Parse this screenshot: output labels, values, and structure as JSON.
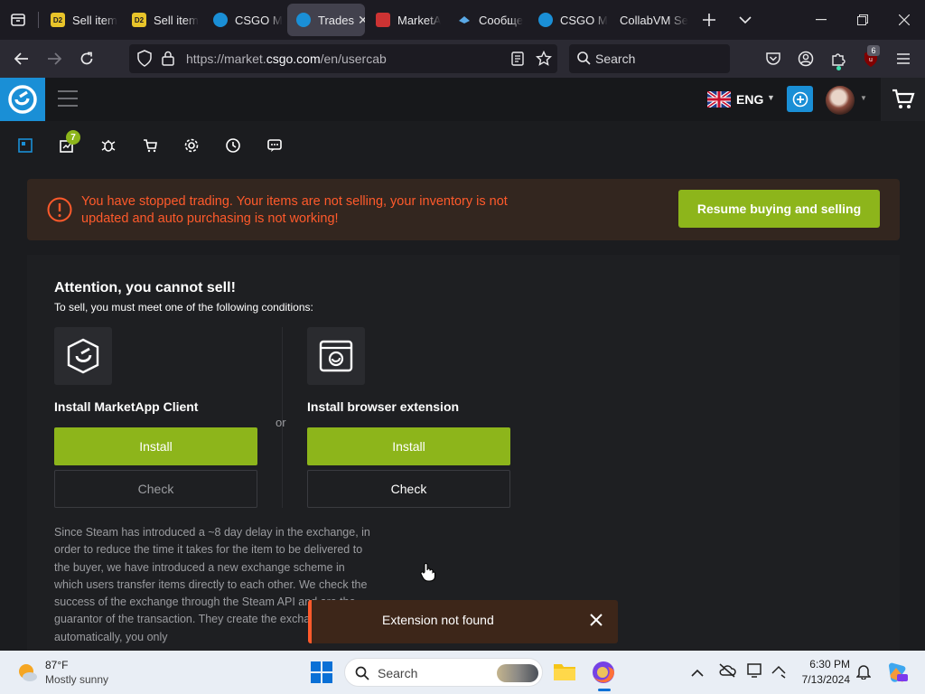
{
  "browser": {
    "tabs": [
      {
        "title": "Sell item",
        "fav": "D2"
      },
      {
        "title": "Sell item",
        "fav": "D2"
      },
      {
        "title": "CSGO M",
        "fav": ""
      },
      {
        "title": "Trades",
        "fav": "",
        "active": true
      },
      {
        "title": "MarketA",
        "fav": ""
      },
      {
        "title": "Сообще",
        "fav": ""
      },
      {
        "title": "CSGO M",
        "fav": ""
      },
      {
        "title": "CollabVM Se",
        "fav": ""
      }
    ],
    "url_prefix": "https://market.",
    "url_domain": "csgo.com",
    "url_path": "/en/usercab",
    "search_placeholder": "Search",
    "extension_badge": "6"
  },
  "site": {
    "language": "ENG",
    "subnav_badge": "7",
    "alert": {
      "message": "You have stopped trading. Your items are not selling, your inventory is not updated and auto purchasing is not working!",
      "button": "Resume buying and selling"
    },
    "panel": {
      "title": "Attention, you cannot sell!",
      "subtitle": "To sell, you must meet one of the following conditions:",
      "or_label": "or",
      "options": [
        {
          "title": "Install MarketApp Client",
          "install": "Install",
          "check": "Check"
        },
        {
          "title": "Install browser extension",
          "install": "Install",
          "check": "Check"
        }
      ],
      "explanation": "Since Steam has introduced a ~8 day delay in the exchange, in order to reduce the time it takes for the item to be delivered to the buyer, we have introduced a new exchange scheme in which users transfer items directly to each other. We check the success of the exchange through the Steam API and are the guarantor of the transaction. They create the exchange for you automatically, you only"
    },
    "toast": {
      "message": "Extension not found"
    }
  },
  "taskbar": {
    "weather_temp": "87°F",
    "weather_desc": "Mostly sunny",
    "search_placeholder": "Search",
    "time": "6:30 PM",
    "date": "7/13/2024"
  },
  "colors": {
    "accent_green": "#8db51b",
    "accent_blue": "#1a8fd6",
    "warning_orange": "#ff5a2b"
  }
}
